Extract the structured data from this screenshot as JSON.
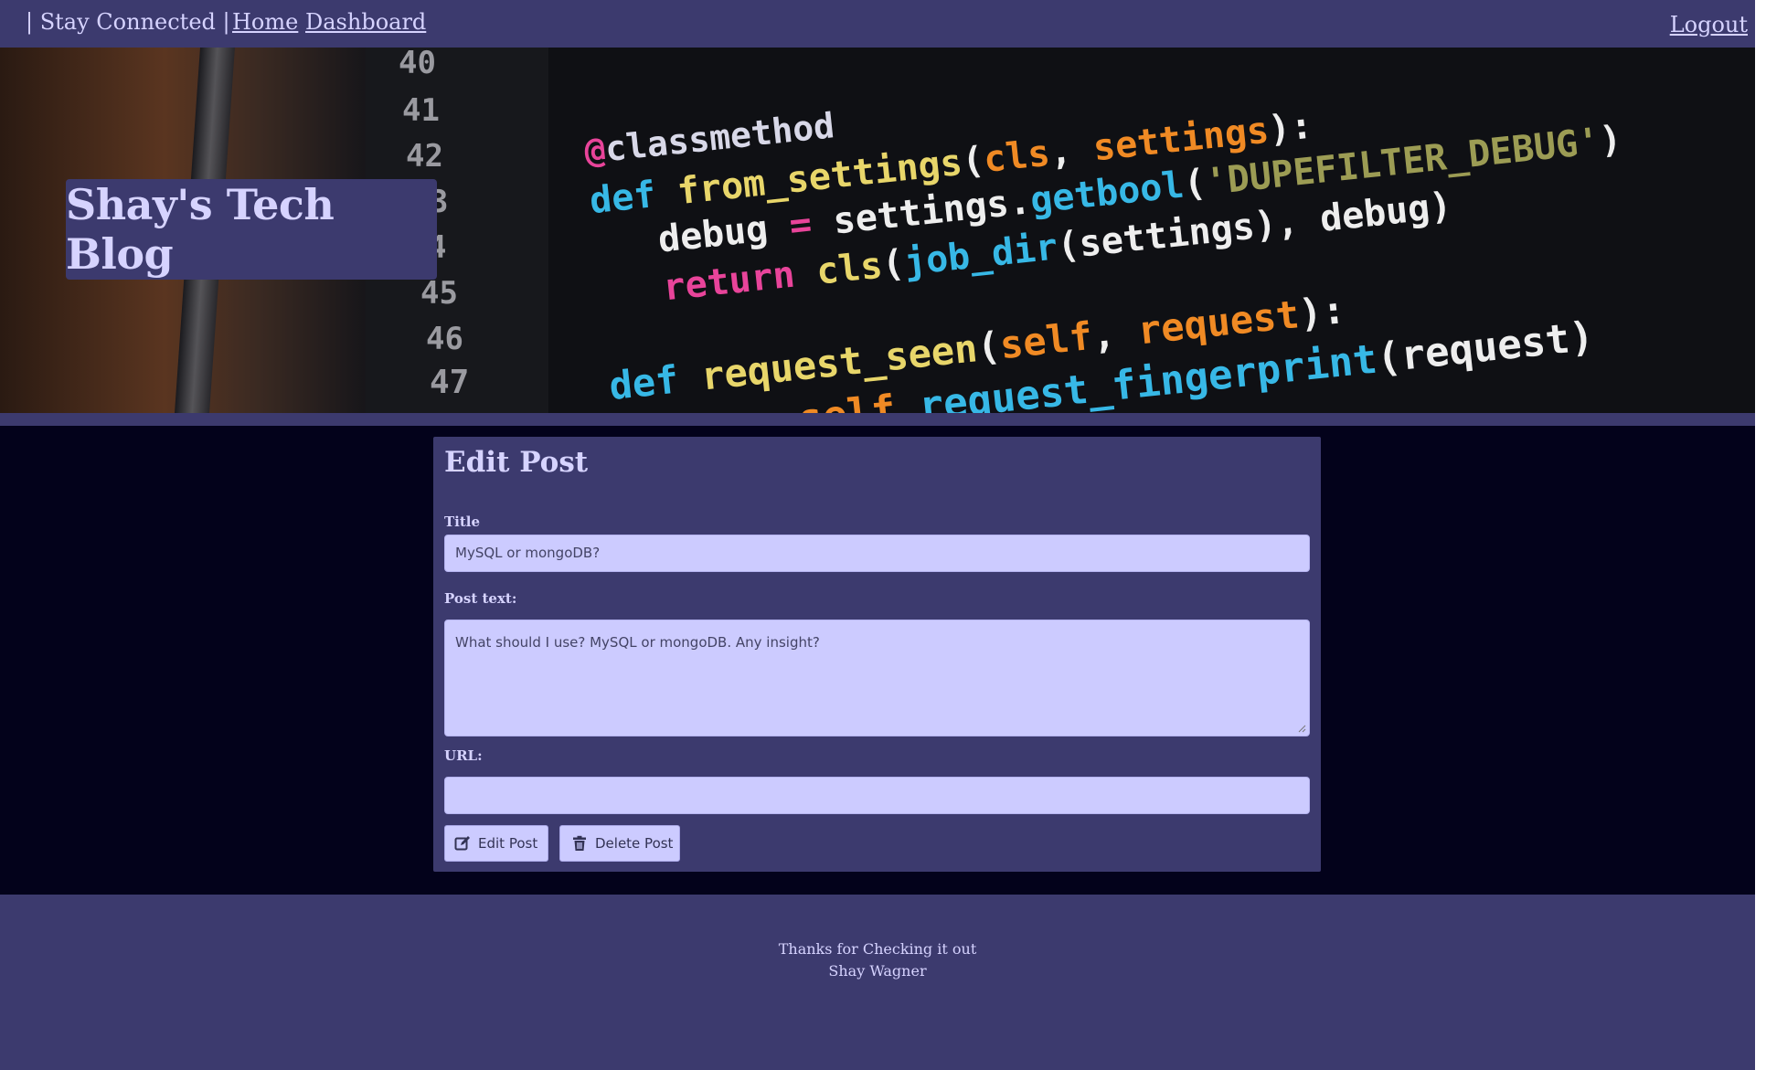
{
  "nav": {
    "brand": "| Stay Connected |",
    "home": "Home",
    "dashboard": "Dashboard",
    "logout": "Logout"
  },
  "hero": {
    "title": "Shay's Tech Blog",
    "image": "code-editor-photo"
  },
  "form": {
    "heading": "Edit Post",
    "title_label": "Title",
    "title_value": "MySQL  or mongoDB?",
    "text_label": "Post text:",
    "text_value": "What should I use?  MySQL or mongoDB.  Any insight?",
    "url_label": "URL:",
    "url_value": "",
    "edit_button": "Edit Post",
    "delete_button": "Delete Post",
    "edit_icon": "edit-icon",
    "delete_icon": "trash-icon"
  },
  "footer": {
    "line1": "Thanks for Checking it out",
    "line2": "Shay Wagner"
  },
  "colors": {
    "nav_bg": "#3c3a6e",
    "main_bg": "#03021b",
    "field_bg": "#cccbff",
    "accent_text": "#d6d3ff"
  }
}
